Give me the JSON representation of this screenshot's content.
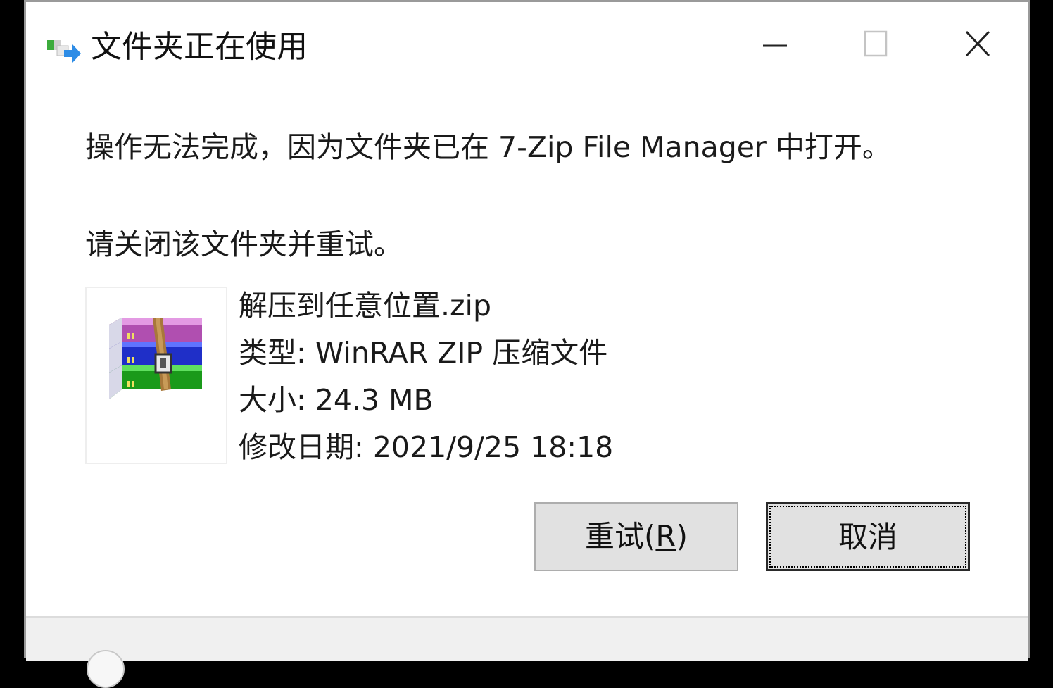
{
  "window": {
    "title": "文件夹正在使用",
    "controls": {
      "minimize_icon": "minimize-icon",
      "maximize_icon": "maximize-icon",
      "close_icon": "close-icon"
    }
  },
  "message": {
    "line1": "操作无法完成，因为文件夹已在 7-Zip File Manager 中打开。",
    "line2": "请关闭该文件夹并重试。"
  },
  "file": {
    "icon": "winrar-archive-icon",
    "name": "解压到任意位置.zip",
    "type": "类型: WinRAR ZIP 压缩文件",
    "size": "大小: 24.3 MB",
    "modified": "修改日期: 2021/9/25 18:18"
  },
  "buttons": {
    "retry_text": "重试(",
    "retry_accel": "R",
    "retry_close": ")",
    "cancel": "取消"
  },
  "footer": {
    "chevron_icon": "chevron-down-icon"
  },
  "colors": {
    "window_bg": "#ffffff",
    "button_bg": "#e1e1e1",
    "footer_bg": "#f0f0f0",
    "text": "#1a1a1a"
  }
}
